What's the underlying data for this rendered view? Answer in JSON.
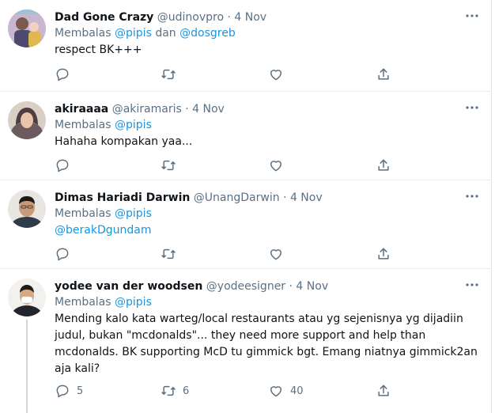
{
  "tweets": [
    {
      "display_name": "Dad Gone Crazy",
      "handle": "@udinovpro",
      "separator": "·",
      "date": "4 Nov",
      "replying_prefix": "Membalas",
      "mentions": [
        "@pipis",
        "@dosgreb"
      ],
      "mention_joiner": "dan",
      "body": "respect BK+++",
      "reply_count": "",
      "retweet_count": "",
      "like_count": ""
    },
    {
      "display_name": "akiraaaa",
      "handle": "@akiramaris",
      "separator": "·",
      "date": "4 Nov",
      "replying_prefix": "Membalas",
      "mentions": [
        "@pipis"
      ],
      "body": "Hahaha kompakan yaa...",
      "reply_count": "",
      "retweet_count": "",
      "like_count": ""
    },
    {
      "display_name": "Dimas Hariadi Darwin",
      "handle": "@UnangDarwin",
      "separator": "·",
      "date": "4 Nov",
      "replying_prefix": "Membalas",
      "mentions": [
        "@pipis"
      ],
      "body_mention": "@berakDgundam",
      "reply_count": "",
      "retweet_count": "",
      "like_count": ""
    },
    {
      "display_name": "yodee van der woodsen",
      "handle": "@yodeesigner",
      "separator": "·",
      "date": "4 Nov",
      "replying_prefix": "Membalas",
      "mentions": [
        "@pipis"
      ],
      "body_lines": [
        "Mending kalo kata warteg/local restaurants atau yg sejenisnya yg dijadiin",
        "judul, bukan \"mcdonalds\"... they need more support and help than",
        "mcdonalds. BK supporting McD tu gimmick bgt. Emang niatnya gimmick2an",
        "aja kali?"
      ],
      "reply_count": "5",
      "retweet_count": "6",
      "like_count": "40"
    }
  ],
  "icons": {
    "reply": "reply-icon",
    "retweet": "retweet-icon",
    "like": "heart-icon",
    "share": "share-icon",
    "more": "more-icon"
  },
  "colors": {
    "link": "#1b95e0",
    "secondary": "#5b7083",
    "border": "#e6ecf0",
    "thread_line": "#ccd6dd"
  }
}
